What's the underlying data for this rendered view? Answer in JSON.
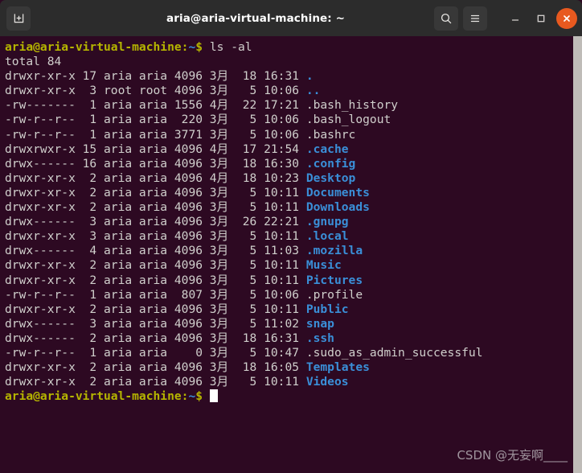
{
  "window": {
    "title": "aria@aria-virtual-machine: ~",
    "titlebar_bg": "#2c2c2c",
    "close_color": "#e8591f",
    "buttons": {
      "new_tab": "new-tab",
      "search": "search",
      "menu": "menu",
      "minimize": "–",
      "maximize": "□",
      "close": "✕"
    }
  },
  "terminal": {
    "bg": "#2d0922",
    "fg": "#d0cfcc",
    "colors": {
      "prompt_user": "#b5b500",
      "prompt_path": "#3a8fd8",
      "directory": "#3a8fd8",
      "file": "#d0cfcc"
    },
    "prompt": {
      "user_host": "aria@aria-virtual-machine",
      "colon": ":",
      "path": "~",
      "dollar": "$"
    },
    "command": "ls -al",
    "total_line": "total 84",
    "entries": [
      {
        "perms": "drwxr-xr-x",
        "links": "17",
        "owner": "aria",
        "group": "aria",
        "size": "4096",
        "month": "3月",
        "day": "18",
        "time": "16:31",
        "name": ".",
        "type": "dir"
      },
      {
        "perms": "drwxr-xr-x",
        "links": " 3",
        "owner": "root",
        "group": "root",
        "size": "4096",
        "month": "3月",
        "day": " 5",
        "time": "10:06",
        "name": "..",
        "type": "dir"
      },
      {
        "perms": "-rw-------",
        "links": " 1",
        "owner": "aria",
        "group": "aria",
        "size": "1556",
        "month": "4月",
        "day": "22",
        "time": "17:21",
        "name": ".bash_history",
        "type": "file"
      },
      {
        "perms": "-rw-r--r--",
        "links": " 1",
        "owner": "aria",
        "group": "aria",
        "size": " 220",
        "month": "3月",
        "day": " 5",
        "time": "10:06",
        "name": ".bash_logout",
        "type": "file"
      },
      {
        "perms": "-rw-r--r--",
        "links": " 1",
        "owner": "aria",
        "group": "aria",
        "size": "3771",
        "month": "3月",
        "day": " 5",
        "time": "10:06",
        "name": ".bashrc",
        "type": "file"
      },
      {
        "perms": "drwxrwxr-x",
        "links": "15",
        "owner": "aria",
        "group": "aria",
        "size": "4096",
        "month": "4月",
        "day": "17",
        "time": "21:54",
        "name": ".cache",
        "type": "dir"
      },
      {
        "perms": "drwx------",
        "links": "16",
        "owner": "aria",
        "group": "aria",
        "size": "4096",
        "month": "3月",
        "day": "18",
        "time": "16:30",
        "name": ".config",
        "type": "dir"
      },
      {
        "perms": "drwxr-xr-x",
        "links": " 2",
        "owner": "aria",
        "group": "aria",
        "size": "4096",
        "month": "4月",
        "day": "18",
        "time": "10:23",
        "name": "Desktop",
        "type": "dir"
      },
      {
        "perms": "drwxr-xr-x",
        "links": " 2",
        "owner": "aria",
        "group": "aria",
        "size": "4096",
        "month": "3月",
        "day": " 5",
        "time": "10:11",
        "name": "Documents",
        "type": "dir"
      },
      {
        "perms": "drwxr-xr-x",
        "links": " 2",
        "owner": "aria",
        "group": "aria",
        "size": "4096",
        "month": "3月",
        "day": " 5",
        "time": "10:11",
        "name": "Downloads",
        "type": "dir"
      },
      {
        "perms": "drwx------",
        "links": " 3",
        "owner": "aria",
        "group": "aria",
        "size": "4096",
        "month": "3月",
        "day": "26",
        "time": "22:21",
        "name": ".gnupg",
        "type": "dir"
      },
      {
        "perms": "drwxr-xr-x",
        "links": " 3",
        "owner": "aria",
        "group": "aria",
        "size": "4096",
        "month": "3月",
        "day": " 5",
        "time": "10:11",
        "name": ".local",
        "type": "dir"
      },
      {
        "perms": "drwx------",
        "links": " 4",
        "owner": "aria",
        "group": "aria",
        "size": "4096",
        "month": "3月",
        "day": " 5",
        "time": "11:03",
        "name": ".mozilla",
        "type": "dir"
      },
      {
        "perms": "drwxr-xr-x",
        "links": " 2",
        "owner": "aria",
        "group": "aria",
        "size": "4096",
        "month": "3月",
        "day": " 5",
        "time": "10:11",
        "name": "Music",
        "type": "dir"
      },
      {
        "perms": "drwxr-xr-x",
        "links": " 2",
        "owner": "aria",
        "group": "aria",
        "size": "4096",
        "month": "3月",
        "day": " 5",
        "time": "10:11",
        "name": "Pictures",
        "type": "dir"
      },
      {
        "perms": "-rw-r--r--",
        "links": " 1",
        "owner": "aria",
        "group": "aria",
        "size": " 807",
        "month": "3月",
        "day": " 5",
        "time": "10:06",
        "name": ".profile",
        "type": "file"
      },
      {
        "perms": "drwxr-xr-x",
        "links": " 2",
        "owner": "aria",
        "group": "aria",
        "size": "4096",
        "month": "3月",
        "day": " 5",
        "time": "10:11",
        "name": "Public",
        "type": "dir"
      },
      {
        "perms": "drwx------",
        "links": " 3",
        "owner": "aria",
        "group": "aria",
        "size": "4096",
        "month": "3月",
        "day": " 5",
        "time": "11:02",
        "name": "snap",
        "type": "dir"
      },
      {
        "perms": "drwx------",
        "links": " 2",
        "owner": "aria",
        "group": "aria",
        "size": "4096",
        "month": "3月",
        "day": "18",
        "time": "16:31",
        "name": ".ssh",
        "type": "dir"
      },
      {
        "perms": "-rw-r--r--",
        "links": " 1",
        "owner": "aria",
        "group": "aria",
        "size": "   0",
        "month": "3月",
        "day": " 5",
        "time": "10:47",
        "name": ".sudo_as_admin_successful",
        "type": "file"
      },
      {
        "perms": "drwxr-xr-x",
        "links": " 2",
        "owner": "aria",
        "group": "aria",
        "size": "4096",
        "month": "3月",
        "day": "18",
        "time": "16:05",
        "name": "Templates",
        "type": "dir"
      },
      {
        "perms": "drwxr-xr-x",
        "links": " 2",
        "owner": "aria",
        "group": "aria",
        "size": "4096",
        "month": "3月",
        "day": " 5",
        "time": "10:11",
        "name": "Videos",
        "type": "dir"
      }
    ]
  },
  "watermark": "CSDN @无妄啊____"
}
